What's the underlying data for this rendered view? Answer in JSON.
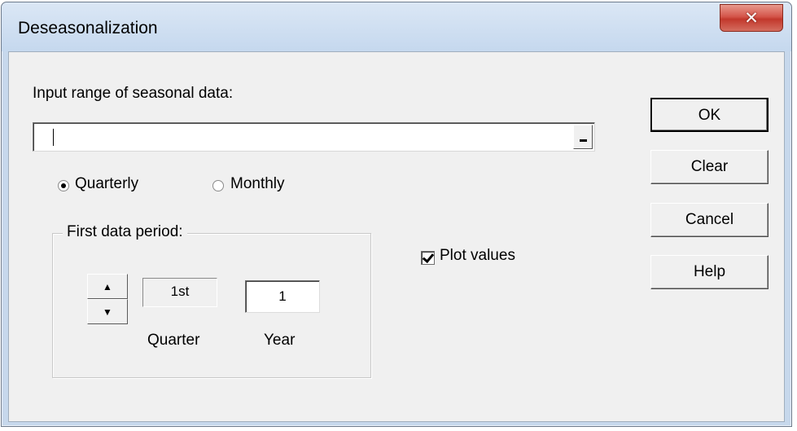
{
  "window": {
    "title": "Deseasonalization",
    "close_glyph": "✕"
  },
  "input_range": {
    "label": "Input range of seasonal data:",
    "value": ""
  },
  "frequency": {
    "options": [
      {
        "label": "Quarterly",
        "selected": true
      },
      {
        "label": "Monthly",
        "selected": false
      }
    ]
  },
  "first_period": {
    "group_label": "First data period:",
    "spin_up_glyph": "▲",
    "spin_down_glyph": "▼",
    "quarter_value": "1st",
    "year_value": "1",
    "quarter_label": "Quarter",
    "year_label": "Year"
  },
  "plot_values": {
    "label": "Plot values",
    "checked": true
  },
  "buttons": {
    "ok": "OK",
    "clear": "Clear",
    "cancel": "Cancel",
    "help": "Help"
  },
  "colors": {
    "titlebar": "#c7d8ec",
    "close_button": "#c8463a",
    "dialog_background": "#f0f0f0"
  }
}
